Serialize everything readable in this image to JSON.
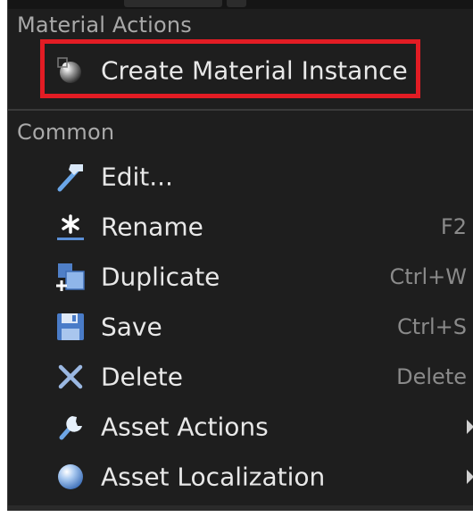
{
  "sections": {
    "material_actions": {
      "title": "Material Actions",
      "create_instance": {
        "label": "Create Material Instance",
        "icon": "material-sphere-icon"
      }
    },
    "common": {
      "title": "Common",
      "items": [
        {
          "label": "Edit...",
          "shortcut": "",
          "icon": "edit-hammer-icon"
        },
        {
          "label": "Rename",
          "shortcut": "F2",
          "icon": "rename-icon"
        },
        {
          "label": "Duplicate",
          "shortcut": "Ctrl+W",
          "icon": "duplicate-icon"
        },
        {
          "label": "Save",
          "shortcut": "Ctrl+S",
          "icon": "save-icon"
        },
        {
          "label": "Delete",
          "shortcut": "Delete",
          "icon": "delete-icon"
        },
        {
          "label": "Asset Actions",
          "shortcut": "",
          "icon": "wrench-icon"
        },
        {
          "label": "Asset Localization",
          "shortcut": "",
          "icon": "globe-icon"
        }
      ]
    }
  },
  "colors": {
    "menu_background": "#1e1e1e",
    "highlight_border": "#e21c24",
    "label_text": "#e8e8e8",
    "header_text": "#a9a9a9",
    "shortcut_text": "#8a8a8a"
  }
}
